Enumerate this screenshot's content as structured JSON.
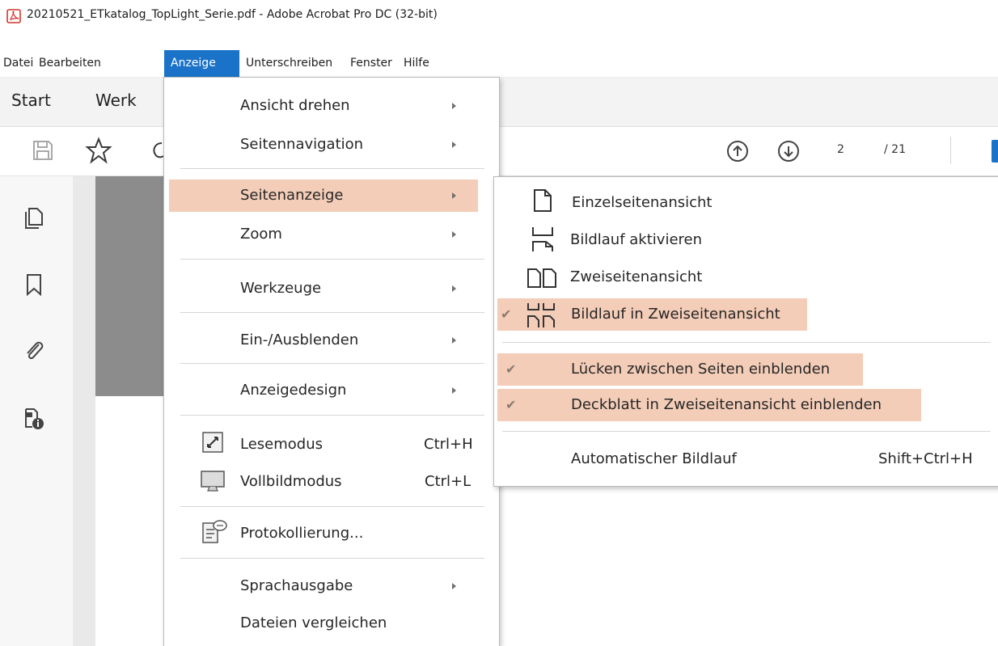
{
  "window": {
    "title": "20210521_ETkatalog_TopLight_Serie.pdf - Adobe Acrobat Pro DC (32-bit)"
  },
  "menubar": [
    "Datei",
    "Bearbeiten",
    "Anzeige",
    "Unterschreiben",
    "Fenster",
    "Hilfe"
  ],
  "tabs": {
    "start": "Start",
    "werkzeuge_partial": "Werk"
  },
  "navigation": {
    "current_page": "2",
    "total_pages": "/ 21"
  },
  "anzeige_menu": {
    "items": [
      {
        "label": "Ansicht drehen",
        "accel": "c",
        "submenu": true
      },
      {
        "label": "Seitennavigation",
        "accel": "n",
        "submenu": true
      },
      {
        "label": "Seitenanzeige",
        "accel": "e",
        "submenu": true,
        "highlighted": true
      },
      {
        "label": "Zoom",
        "accel": "Z",
        "submenu": true
      },
      {
        "label": "Werkzeuge",
        "accel": "W",
        "submenu": true
      },
      {
        "label": "Ein-/Ausblenden",
        "accel": "s",
        "submenu": true
      },
      {
        "label": "Anzeigedesign",
        "accel": "d",
        "submenu": true
      },
      {
        "label": "Lesemodus",
        "accel": "m",
        "shortcut": "Ctrl+H",
        "icon": "reading-mode-icon"
      },
      {
        "label": "Vollbildmodus",
        "accel": "V",
        "shortcut": "Ctrl+L",
        "icon": "fullscreen-icon"
      },
      {
        "label": "Protokollierung...",
        "accel": "o",
        "icon": "tracker-icon"
      },
      {
        "label": "Sprachausgabe",
        "accel": "p",
        "submenu": true
      },
      {
        "label": "Dateien vergleichen",
        "accel": "D"
      }
    ]
  },
  "seitenanzeige_submenu": {
    "items": [
      {
        "label": "Einzelseitenansicht",
        "icon": "single-page-icon",
        "checked": false
      },
      {
        "label": "Bildlauf aktivieren",
        "icon": "scrolling-icon",
        "checked": false
      },
      {
        "label": "Zweiseitenansicht",
        "icon": "two-page-icon",
        "checked": false
      },
      {
        "label": "Bildlauf in Zweiseitenansicht",
        "icon": "two-page-scrolling-icon",
        "checked": true,
        "highlighted": true
      },
      {
        "label": "Lücken zwischen Seiten einblenden",
        "checked": true,
        "highlighted": true
      },
      {
        "label": "Deckblatt in Zweiseitenansicht einblenden",
        "checked": true,
        "highlighted": true
      },
      {
        "label": "Automatischer Bildlauf",
        "shortcut": "Shift+Ctrl+H"
      }
    ]
  },
  "colors": {
    "menu_highlight": "#f4cdb8",
    "menubar_active": "#1a73c8",
    "toolbar_blue": "#1a73c8"
  }
}
